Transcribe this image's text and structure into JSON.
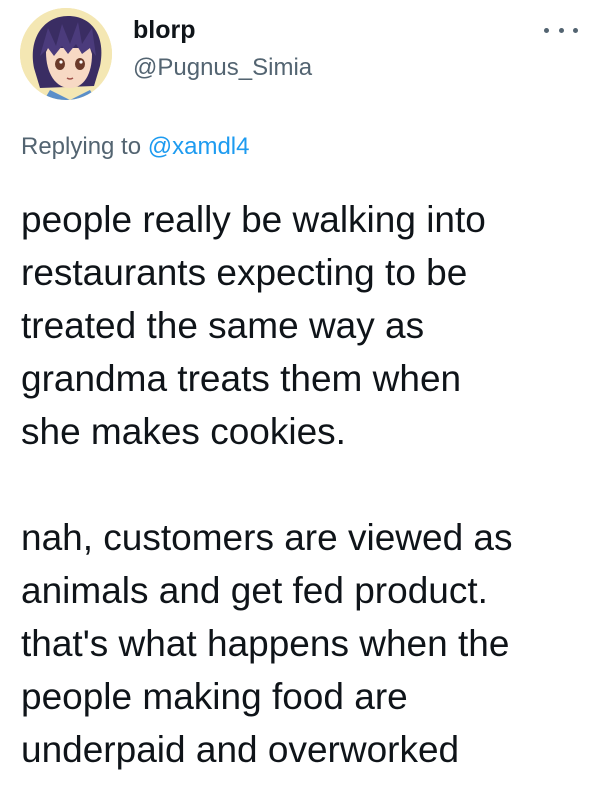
{
  "author": {
    "display_name": "blorp",
    "handle": "@Pugnus_Simia",
    "avatar_icon": "anime-character-avatar"
  },
  "more_icon": "more-options-icon",
  "reply": {
    "prefix": "Replying to",
    "mention": "@xamdl4"
  },
  "tweet": {
    "paragraph1": [
      "people really be walking into",
      "restaurants expecting to be",
      "treated the same way as",
      "grandma treats them when",
      "she makes cookies."
    ],
    "paragraph2": [
      "nah, customers are viewed as",
      "animals and get fed product.",
      "that's what happens when the",
      "people making food are",
      "underpaid and overworked"
    ]
  },
  "colors": {
    "text": "#0f1419",
    "secondary": "#536471",
    "link": "#1d9bf0"
  }
}
